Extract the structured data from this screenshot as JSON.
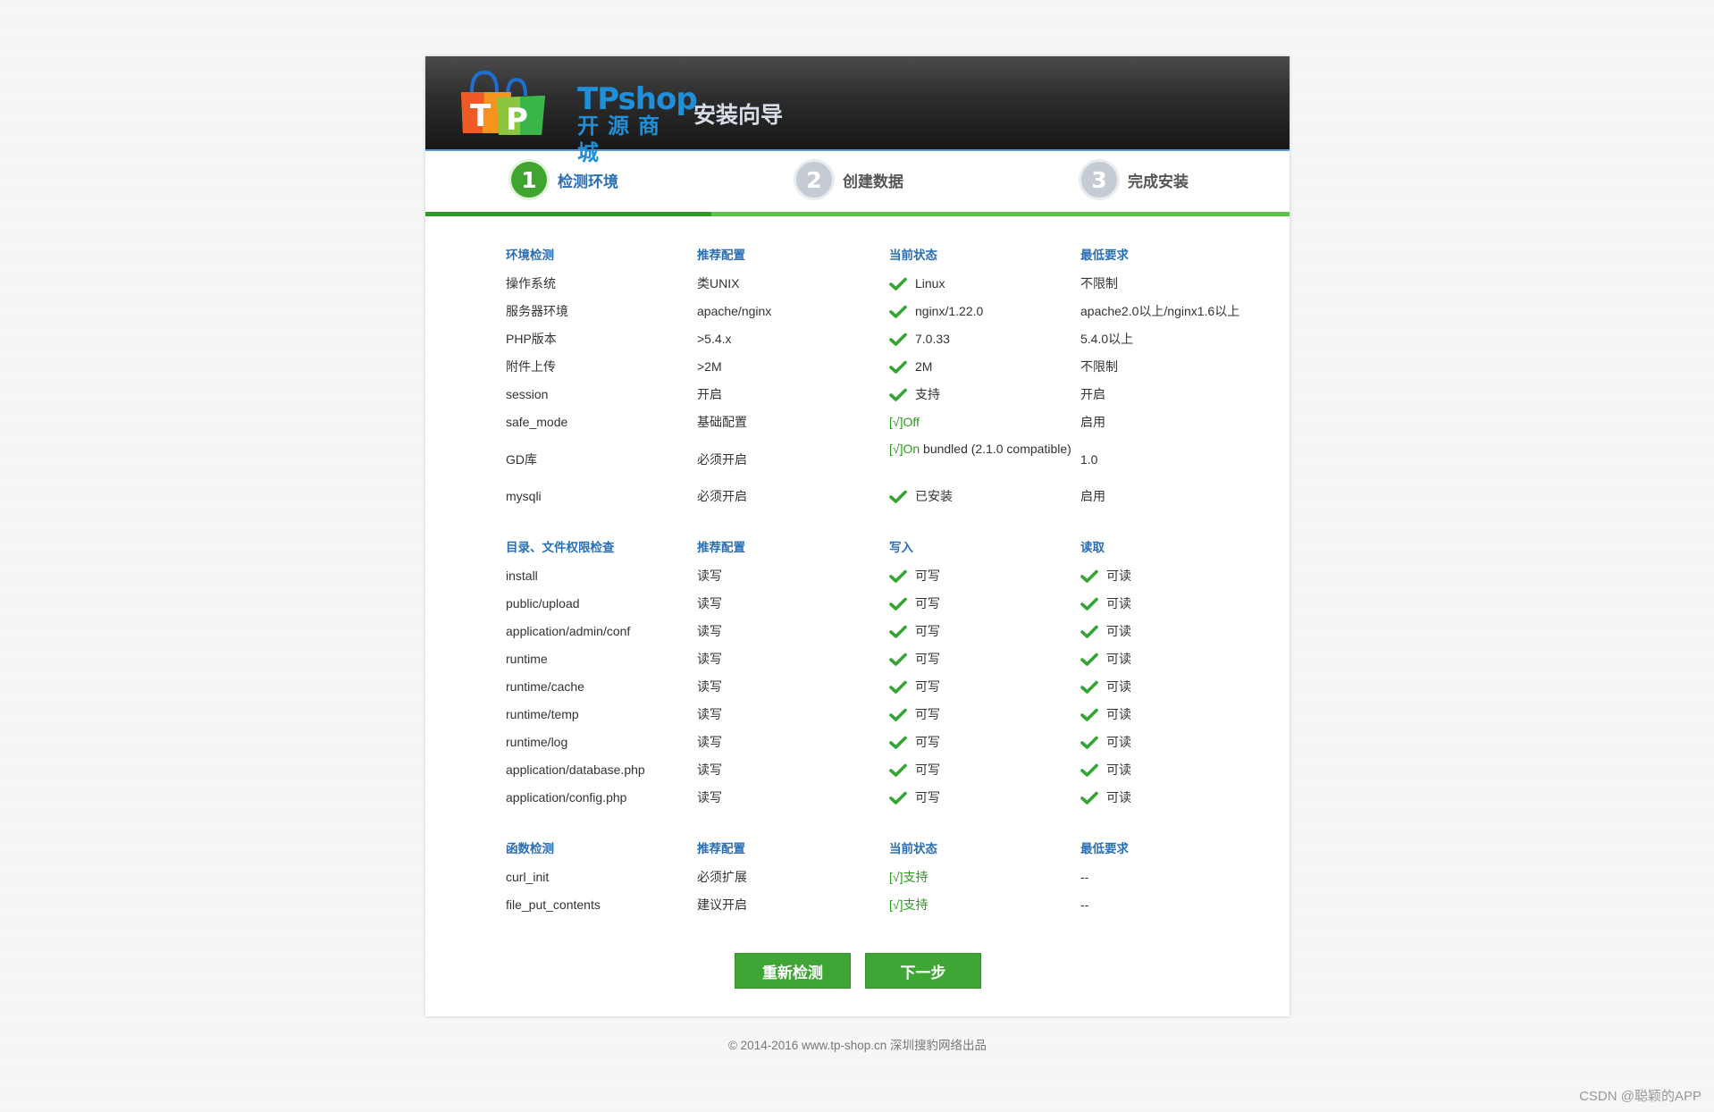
{
  "header": {
    "logo_en": "TPshop",
    "logo_cn": "开源商城",
    "title": "安装向导"
  },
  "steps": [
    {
      "num": "1",
      "label": "检测环境",
      "active": true
    },
    {
      "num": "2",
      "label": "创建数据",
      "active": false
    },
    {
      "num": "3",
      "label": "完成安装",
      "active": false
    }
  ],
  "env_section": {
    "headers": [
      "环境检测",
      "推荐配置",
      "当前状态",
      "最低要求"
    ],
    "rows": [
      {
        "name": "操作系统",
        "recommend": "类UNIX",
        "status": "Linux",
        "status_icon": "check-icon",
        "min": "不限制"
      },
      {
        "name": "服务器环境",
        "recommend": "apache/nginx",
        "status": "nginx/1.22.0",
        "status_icon": "check-icon",
        "min": "apache2.0以上/nginx1.6以上"
      },
      {
        "name": "PHP版本",
        "recommend": ">5.4.x",
        "status": "7.0.33",
        "status_icon": "check-icon",
        "min": "5.4.0以上"
      },
      {
        "name": "附件上传",
        "recommend": ">2M",
        "status": "2M",
        "status_icon": "check-icon",
        "min": "不限制"
      },
      {
        "name": "session",
        "recommend": "开启",
        "status": "支持",
        "status_icon": "check-icon",
        "min": "开启"
      },
      {
        "name": "safe_mode",
        "recommend": "基础配置",
        "status_prefix": "[√]Off",
        "status": "",
        "min": "启用"
      },
      {
        "name": "GD库",
        "recommend": "必须开启",
        "status_prefix": "[√]On",
        "status": " bundled (2.1.0 compatible)",
        "min": "1.0"
      },
      {
        "name": "mysqli",
        "recommend": "必须开启",
        "status": "已安装",
        "status_icon": "check-icon",
        "min": "启用"
      }
    ]
  },
  "dir_section": {
    "headers": [
      "目录、文件权限检查",
      "推荐配置",
      "写入",
      "读取"
    ],
    "rows": [
      {
        "path": "install",
        "recommend": "读写",
        "write": "可写",
        "read": "可读"
      },
      {
        "path": "public/upload",
        "recommend": "读写",
        "write": "可写",
        "read": "可读"
      },
      {
        "path": "application/admin/conf",
        "recommend": "读写",
        "write": "可写",
        "read": "可读"
      },
      {
        "path": "runtime",
        "recommend": "读写",
        "write": "可写",
        "read": "可读"
      },
      {
        "path": "runtime/cache",
        "recommend": "读写",
        "write": "可写",
        "read": "可读"
      },
      {
        "path": "runtime/temp",
        "recommend": "读写",
        "write": "可写",
        "read": "可读"
      },
      {
        "path": "runtime/log",
        "recommend": "读写",
        "write": "可写",
        "read": "可读"
      },
      {
        "path": "application/database.php",
        "recommend": "读写",
        "write": "可写",
        "read": "可读"
      },
      {
        "path": "application/config.php",
        "recommend": "读写",
        "write": "可写",
        "read": "可读"
      }
    ]
  },
  "func_section": {
    "headers": [
      "函数检测",
      "推荐配置",
      "当前状态",
      "最低要求"
    ],
    "rows": [
      {
        "name": "curl_init",
        "recommend": "必须扩展",
        "status": "[√]支持",
        "min": "--"
      },
      {
        "name": "file_put_contents",
        "recommend": "建议开启",
        "status": "[√]支持",
        "min": "--"
      }
    ]
  },
  "buttons": {
    "recheck": "重新检测",
    "next": "下一步"
  },
  "footer": "© 2014-2016 www.tp-shop.cn 深圳搜豹网络出品",
  "watermark": "CSDN @聪颖的APP",
  "colors": {
    "accent_blue": "#2a6fb5",
    "success_green": "#2c9b1e",
    "button_green": "#3fa535"
  }
}
